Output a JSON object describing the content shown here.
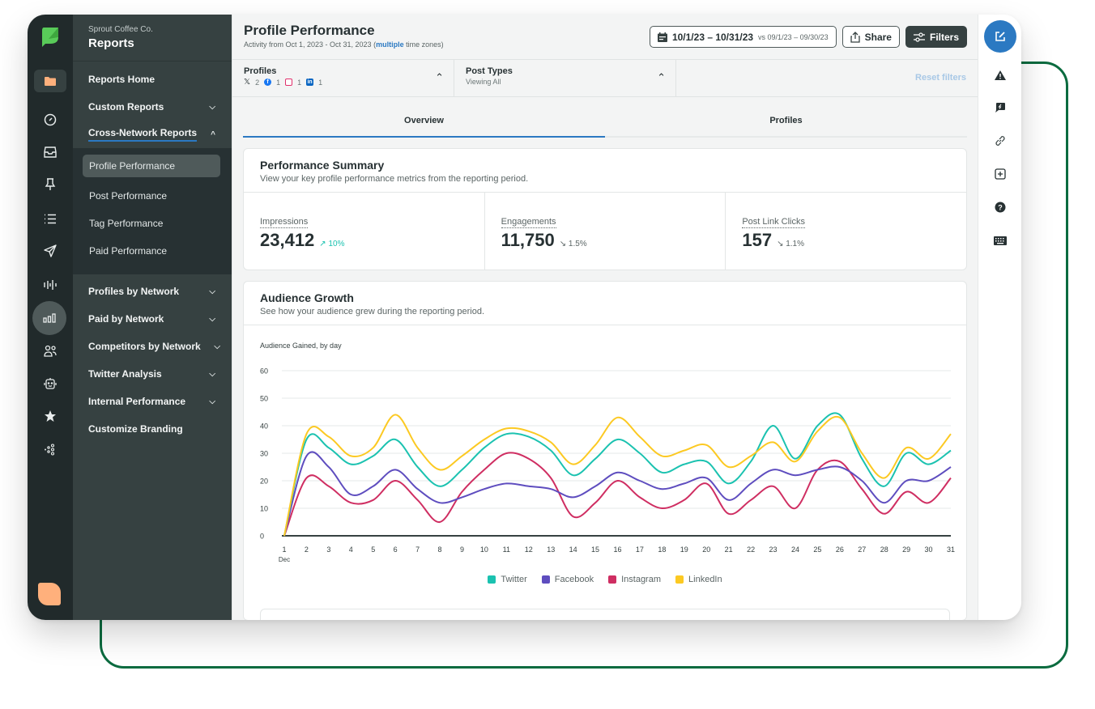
{
  "org_name": "Sprout Coffee Co.",
  "section_title": "Reports",
  "rail_icons": [
    "folder-icon",
    "gauge-icon",
    "inbox-icon",
    "pin-icon",
    "list-icon",
    "send-icon",
    "listening-icon",
    "analytics-icon",
    "people-icon",
    "bot-icon",
    "star-icon",
    "network-icon"
  ],
  "nav": {
    "items_top": [
      {
        "label": "Reports Home",
        "chevron": ""
      },
      {
        "label": "Custom Reports",
        "chevron": "down"
      },
      {
        "label": "Cross-Network Reports",
        "chevron": "up"
      }
    ],
    "sub_items": [
      {
        "label": "Profile Performance",
        "active": true
      },
      {
        "label": "Post Performance",
        "active": false
      },
      {
        "label": "Tag Performance",
        "active": false
      },
      {
        "label": "Paid Performance",
        "active": false
      }
    ],
    "items_bottom": [
      {
        "label": "Profiles by Network",
        "chevron": "down"
      },
      {
        "label": "Paid by Network",
        "chevron": "down"
      },
      {
        "label": "Competitors by Network",
        "chevron": "down"
      },
      {
        "label": "Twitter Analysis",
        "chevron": "down"
      },
      {
        "label": "Internal Performance",
        "chevron": "down"
      },
      {
        "label": "Customize Branding",
        "chevron": ""
      }
    ]
  },
  "header": {
    "title": "Profile Performance",
    "subtitle_prefix": "Activity from Oct 1, 2023 - Oct 31, 2023 (",
    "subtitle_link": "multiple",
    "subtitle_suffix": " time zones)",
    "date_range": "10/1/23 – 10/31/23",
    "compare_range": "vs 09/1/23 – 09/30/23",
    "share_label": "Share",
    "filters_label": "Filters"
  },
  "filters": {
    "profiles_title": "Profiles",
    "profiles_counts": [
      {
        "network": "x",
        "count": "2"
      },
      {
        "network": "facebook",
        "count": "1"
      },
      {
        "network": "instagram",
        "count": "1"
      },
      {
        "network": "linkedin",
        "count": "1"
      }
    ],
    "post_types_title": "Post Types",
    "post_types_value": "Viewing All",
    "reset_label": "Reset filters"
  },
  "tabs": [
    {
      "label": "Overview",
      "active": true
    },
    {
      "label": "Profiles",
      "active": false
    }
  ],
  "summary": {
    "title": "Performance Summary",
    "subtitle": "View your key profile performance metrics from the reporting period.",
    "metrics": [
      {
        "label": "Impressions",
        "value": "23,412",
        "delta": "↗ 10%",
        "direction": "up"
      },
      {
        "label": "Engagements",
        "value": "11,750",
        "delta": "↘ 1.5%",
        "direction": "down"
      },
      {
        "label": "Post Link Clicks",
        "value": "157",
        "delta": "↘ 1.1%",
        "direction": "down"
      }
    ]
  },
  "audience": {
    "title": "Audience Growth",
    "subtitle": "See how your audience grew during the reporting period."
  },
  "chart_data": {
    "type": "line",
    "title": "Audience Gained, by day",
    "xlabel": "Dec",
    "ylabel": "",
    "ylim": [
      0,
      60
    ],
    "yticks": [
      0,
      10,
      20,
      30,
      40,
      50,
      60
    ],
    "grid": true,
    "legend_position": "bottom",
    "x": [
      1,
      2,
      3,
      4,
      5,
      6,
      7,
      8,
      9,
      10,
      11,
      12,
      13,
      14,
      15,
      16,
      17,
      18,
      19,
      20,
      21,
      22,
      23,
      24,
      25,
      26,
      27,
      28,
      29,
      30,
      31
    ],
    "series": [
      {
        "name": "Twitter",
        "color": "#1bc2b0",
        "values": [
          0,
          35,
          32,
          26,
          29,
          35,
          25,
          18,
          24,
          32,
          37,
          36,
          31,
          22,
          28,
          35,
          30,
          23,
          26,
          27,
          19,
          27,
          40,
          28,
          40,
          44,
          28,
          18,
          30,
          26,
          31
        ]
      },
      {
        "name": "Facebook",
        "color": "#5e4dbf",
        "values": [
          0,
          29,
          25,
          15,
          18,
          24,
          17,
          12,
          14,
          17,
          19,
          18,
          17,
          14,
          18,
          23,
          20,
          17,
          19,
          21,
          13,
          19,
          24,
          22,
          24,
          25,
          20,
          12,
          20,
          20,
          25
        ]
      },
      {
        "name": "Instagram",
        "color": "#cf2e62",
        "values": [
          0,
          21,
          18,
          12,
          13,
          20,
          13,
          5,
          16,
          24,
          30,
          28,
          21,
          7,
          12,
          20,
          14,
          10,
          13,
          19,
          8,
          13,
          18,
          10,
          24,
          27,
          17,
          8,
          16,
          12,
          21
        ]
      },
      {
        "name": "LinkedIn",
        "color": "#fcc922",
        "values": [
          0,
          37,
          36,
          29,
          32,
          44,
          32,
          24,
          29,
          35,
          39,
          38,
          34,
          26,
          33,
          43,
          36,
          29,
          31,
          33,
          25,
          29,
          34,
          27,
          38,
          43,
          30,
          21,
          32,
          28,
          37
        ]
      }
    ]
  }
}
